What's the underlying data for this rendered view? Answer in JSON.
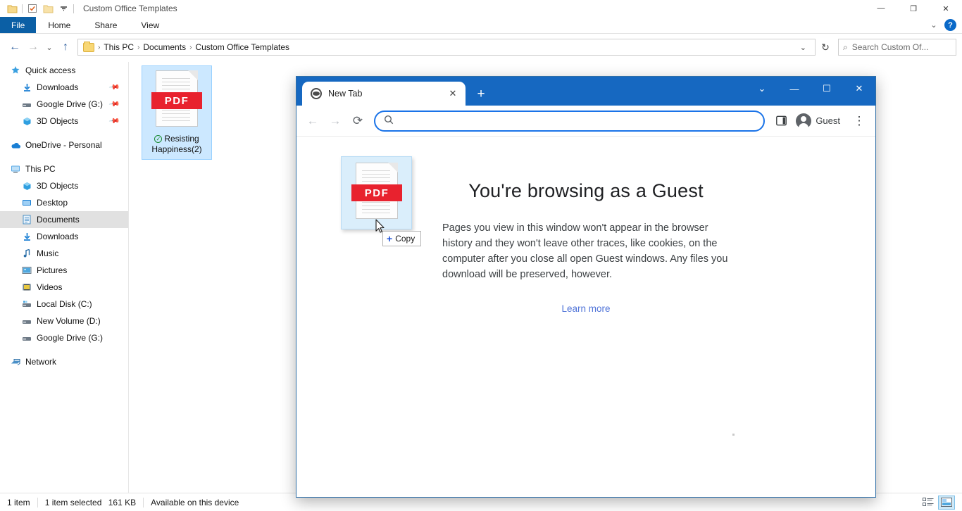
{
  "explorer": {
    "title": "Custom Office Templates",
    "quick_access_toolbar": [
      {
        "name": "folder-icon",
        "label": ""
      },
      {
        "name": "properties-icon",
        "label": ""
      },
      {
        "name": "new-folder-icon",
        "label": ""
      },
      {
        "name": "customize-dropdown-icon",
        "label": "▾"
      }
    ],
    "window_controls": {
      "minimize": "—",
      "maximize": "❐",
      "close": "✕"
    },
    "ribbon": {
      "tabs": [
        "File",
        "Home",
        "Share",
        "View"
      ],
      "active_tab": "File",
      "collapse_icon": "⌄",
      "help_label": "?"
    },
    "address": {
      "back_icon": "←",
      "forward_icon": "→",
      "recent_icon": "⌄",
      "up_icon": "↑",
      "breadcrumbs": [
        "This PC",
        "Documents",
        "Custom Office Templates"
      ],
      "separator": "›",
      "dropdown_icon": "⌄",
      "refresh_icon": "↻",
      "search_icon": "⌕",
      "search_placeholder": "Search Custom Of..."
    },
    "sidebar": {
      "groups": [
        {
          "header": {
            "label": "Quick access",
            "icon": "star-icon"
          },
          "items": [
            {
              "label": "Downloads",
              "icon": "download-icon",
              "pinned": true
            },
            {
              "label": "Google Drive (G:)",
              "icon": "drive-icon",
              "pinned": true
            },
            {
              "label": "3D Objects",
              "icon": "cube-icon",
              "pinned": true
            }
          ]
        },
        {
          "header": {
            "label": "OneDrive - Personal",
            "icon": "cloud-icon"
          },
          "items": []
        },
        {
          "header": {
            "label": "This PC",
            "icon": "monitor-icon"
          },
          "items": [
            {
              "label": "3D Objects",
              "icon": "cube-icon",
              "pinned": false
            },
            {
              "label": "Desktop",
              "icon": "desktop-icon",
              "pinned": false
            },
            {
              "label": "Documents",
              "icon": "documents-icon",
              "pinned": false,
              "selected": true
            },
            {
              "label": "Downloads",
              "icon": "download-icon",
              "pinned": false
            },
            {
              "label": "Music",
              "icon": "music-icon",
              "pinned": false
            },
            {
              "label": "Pictures",
              "icon": "pictures-icon",
              "pinned": false
            },
            {
              "label": "Videos",
              "icon": "videos-icon",
              "pinned": false
            },
            {
              "label": "Local Disk (C:)",
              "icon": "disk-icon",
              "pinned": false
            },
            {
              "label": "New Volume (D:)",
              "icon": "drive-icon",
              "pinned": false
            },
            {
              "label": "Google Drive (G:)",
              "icon": "drive-icon",
              "pinned": false
            }
          ]
        },
        {
          "header": {
            "label": "Network",
            "icon": "network-icon"
          },
          "items": []
        }
      ]
    },
    "files": [
      {
        "name": "Resisting Happiness(2)",
        "type": "PDF",
        "badge": "PDF",
        "sync_status": "available-on-this-device",
        "sync_glyph": "✓",
        "selected": true
      }
    ],
    "status_bar": {
      "item_count": "1 item",
      "selection": "1 item selected",
      "size": "161 KB",
      "availability": "Available on this device",
      "view_details_icon": "details-view-icon",
      "view_large_icon": "large-icons-view-icon"
    }
  },
  "drag": {
    "tooltip_plus": "+",
    "tooltip_label": "Copy",
    "ghost_badge": "PDF"
  },
  "browser": {
    "tab": {
      "title": "New Tab",
      "favicon": "globe-icon",
      "close_icon": "✕"
    },
    "new_tab_icon": "+",
    "window_controls": {
      "chevron": "⌄",
      "minimize": "—",
      "maximize": "☐",
      "close": "✕"
    },
    "toolbar": {
      "back_icon": "←",
      "forward_icon": "→",
      "reload_icon": "⟳",
      "omnibox_search_icon": "⌕",
      "omnibox_value": "",
      "omnibox_placeholder": "",
      "side_panel_icon": "side-panel-icon",
      "profile_label": "Guest",
      "menu_icon": "⋮"
    },
    "page": {
      "heading": "You're browsing as a Guest",
      "body": "Pages you view in this window won't appear in the browser history and they won't leave other traces, like cookies, on the computer after you close all open Guest windows. Any files you download will be preserved, however.",
      "link": "Learn more"
    }
  },
  "colors": {
    "explorer_file_tab": "#0b5fa5",
    "browser_titlebar": "#1668c1",
    "omnibox_focus": "#1a73e8",
    "pdf_red": "#e8222e",
    "link_blue": "#4f73d8",
    "selection_blue": "#cce8ff"
  }
}
